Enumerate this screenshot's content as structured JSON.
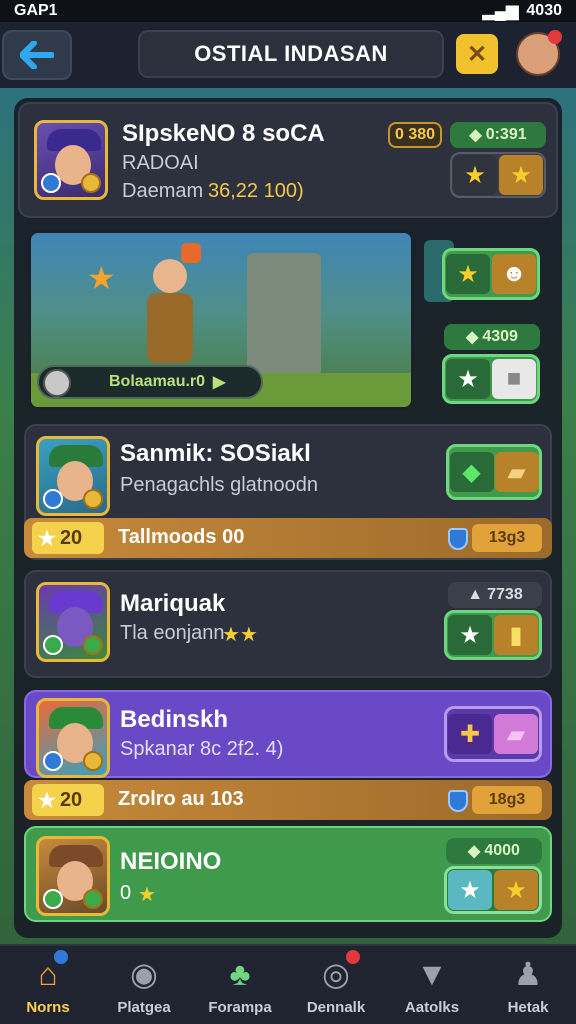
{
  "status": {
    "time": "GAP1",
    "right": "4030"
  },
  "header": {
    "title": "OSTIAL INDASAN",
    "close_symbol": "✕"
  },
  "cards": [
    {
      "name": "SIpskeNO 8 soCA",
      "line1": "RADOAI",
      "line2_prefix": "Daemam",
      "line2_value": "36,22 100)",
      "pill_gold": "0 380",
      "pill_green": "0:391"
    },
    {
      "scene_label": "Bolaamau.r0",
      "pill_green2": "4309"
    },
    {
      "name": "Sanmik: SOSiakl",
      "line1": "Penagachls glatnoodn",
      "bar_level": "20",
      "bar_text": "Tallmoods 00",
      "bar_value": "13g3"
    },
    {
      "name": "Mariquak",
      "line1": "Tla eonjann",
      "pill_gray": "7738"
    },
    {
      "name": "Bedinskh",
      "line1": "Spkanar 8c 2f2. 4)",
      "bar_level": "20",
      "bar_text": "Zrolro au 103",
      "bar_value": "18g3"
    },
    {
      "name": "NEIOINO",
      "line1": "0",
      "pill_green": "4000"
    }
  ],
  "tabs": [
    {
      "label": "Norns",
      "icon": "home-icon"
    },
    {
      "label": "Platgea",
      "icon": "disc-icon"
    },
    {
      "label": "Forampa",
      "icon": "tree-icon"
    },
    {
      "label": "Dennalk",
      "icon": "chat-icon"
    },
    {
      "label": "Aatolks",
      "icon": "gem-icon"
    },
    {
      "label": "Hetak",
      "icon": "person-icon"
    }
  ],
  "colors": {
    "accent_gold": "#f2c12e",
    "accent_green": "#3f9a4c",
    "accent_purple": "#6a49c6"
  }
}
